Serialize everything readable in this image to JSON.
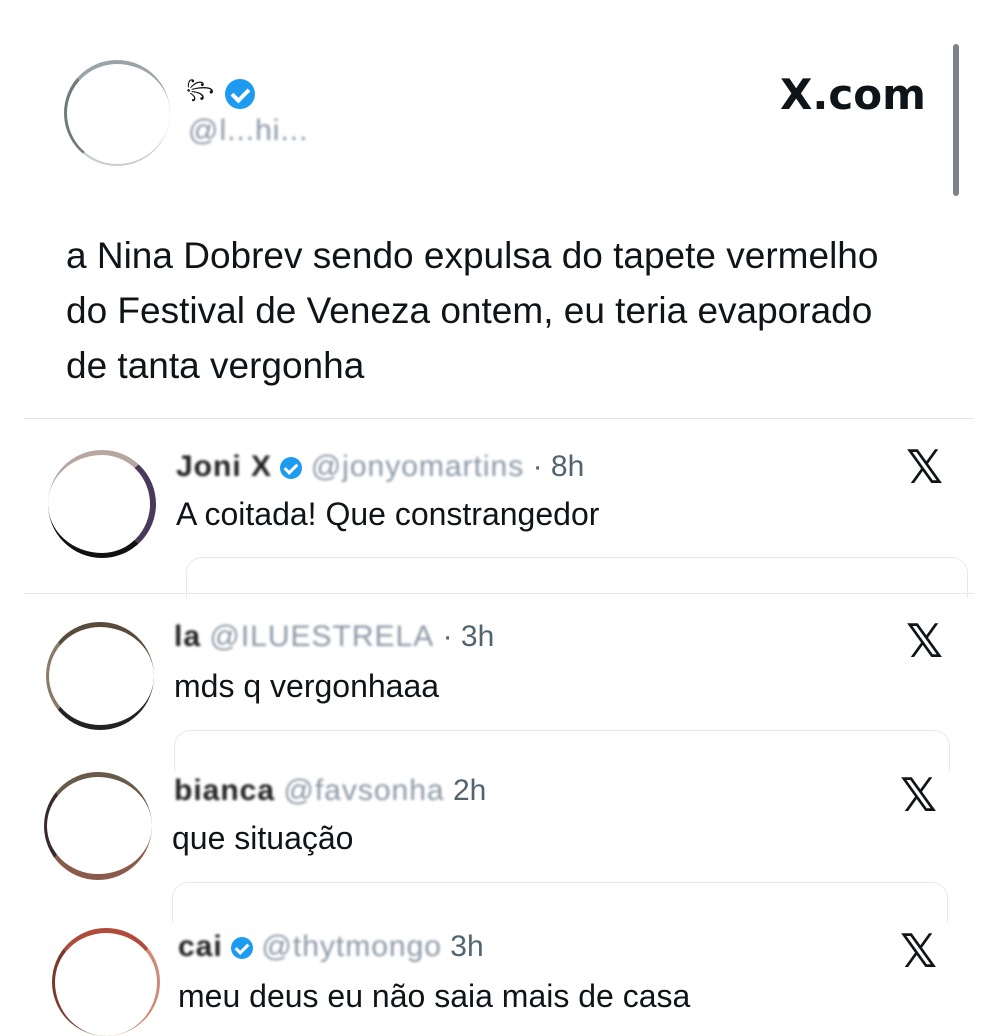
{
  "header": {
    "display_name": "꧂",
    "handle": "@l...hi...",
    "brand": "X.com"
  },
  "post": {
    "text_lines": [
      "a Nina Dobrev sendo expulsa do tapete vermelho",
      "do Festival de Veneza ontem, eu teria evaporado",
      "de tanta vergonha"
    ]
  },
  "replies": [
    {
      "name": "Joni X",
      "handle": "@jonyomartins",
      "time": "· 8h",
      "text": "A coitada! Que constrangedor",
      "logo": "𝕏"
    },
    {
      "name": "la",
      "handle": "@ILUESTRELA",
      "time": "· 3h",
      "text": "mds q vergonhaaa",
      "logo": "𝕏"
    },
    {
      "name": "bianca",
      "handle": "@favsonha",
      "time": "2h",
      "text": "que situação",
      "logo": "𝕏"
    },
    {
      "name": "cai",
      "handle": "@thytmongo",
      "time": "3h",
      "text": "meu deus eu não saia mais de casa",
      "logo": "𝕏"
    }
  ],
  "colors": {
    "verified": "#1d9bf0",
    "text": "#0f1419",
    "meta": "#536471"
  },
  "icons": {
    "verified": "verified-badge-icon",
    "x_logo": "x-logo-icon"
  }
}
